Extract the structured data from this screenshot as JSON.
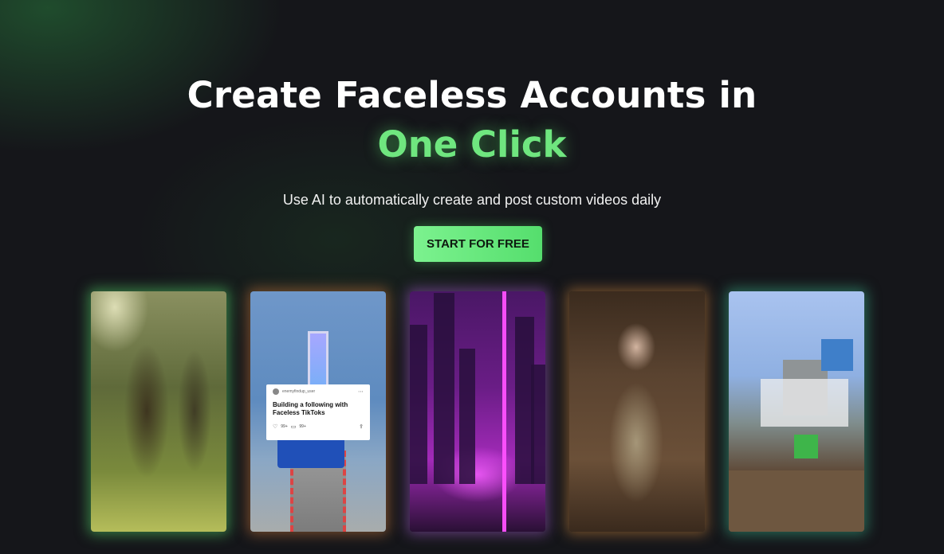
{
  "hero": {
    "title": "Create Faceless Accounts in",
    "accent": "One Click",
    "subtitle": "Use AI to automatically create and post custom videos daily",
    "cta_label": "START FOR FREE"
  },
  "colors": {
    "background": "#15161a",
    "accent": "#6fe67f",
    "cta": "#6be982"
  },
  "cards": [
    {
      "theme": "mossy forest",
      "glow": "#50c864"
    },
    {
      "theme": "car stunt ramp",
      "glow": "#c8783c",
      "post": {
        "username": "enemyfindup_user",
        "text": "Building a following with Faceless TikToks",
        "likes": "99+",
        "comments": "99+"
      }
    },
    {
      "theme": "neon city",
      "glow": "#a05ac8"
    },
    {
      "theme": "child in barn",
      "glow": "#c8823c"
    },
    {
      "theme": "block world",
      "glow": "#3cb48c"
    }
  ]
}
